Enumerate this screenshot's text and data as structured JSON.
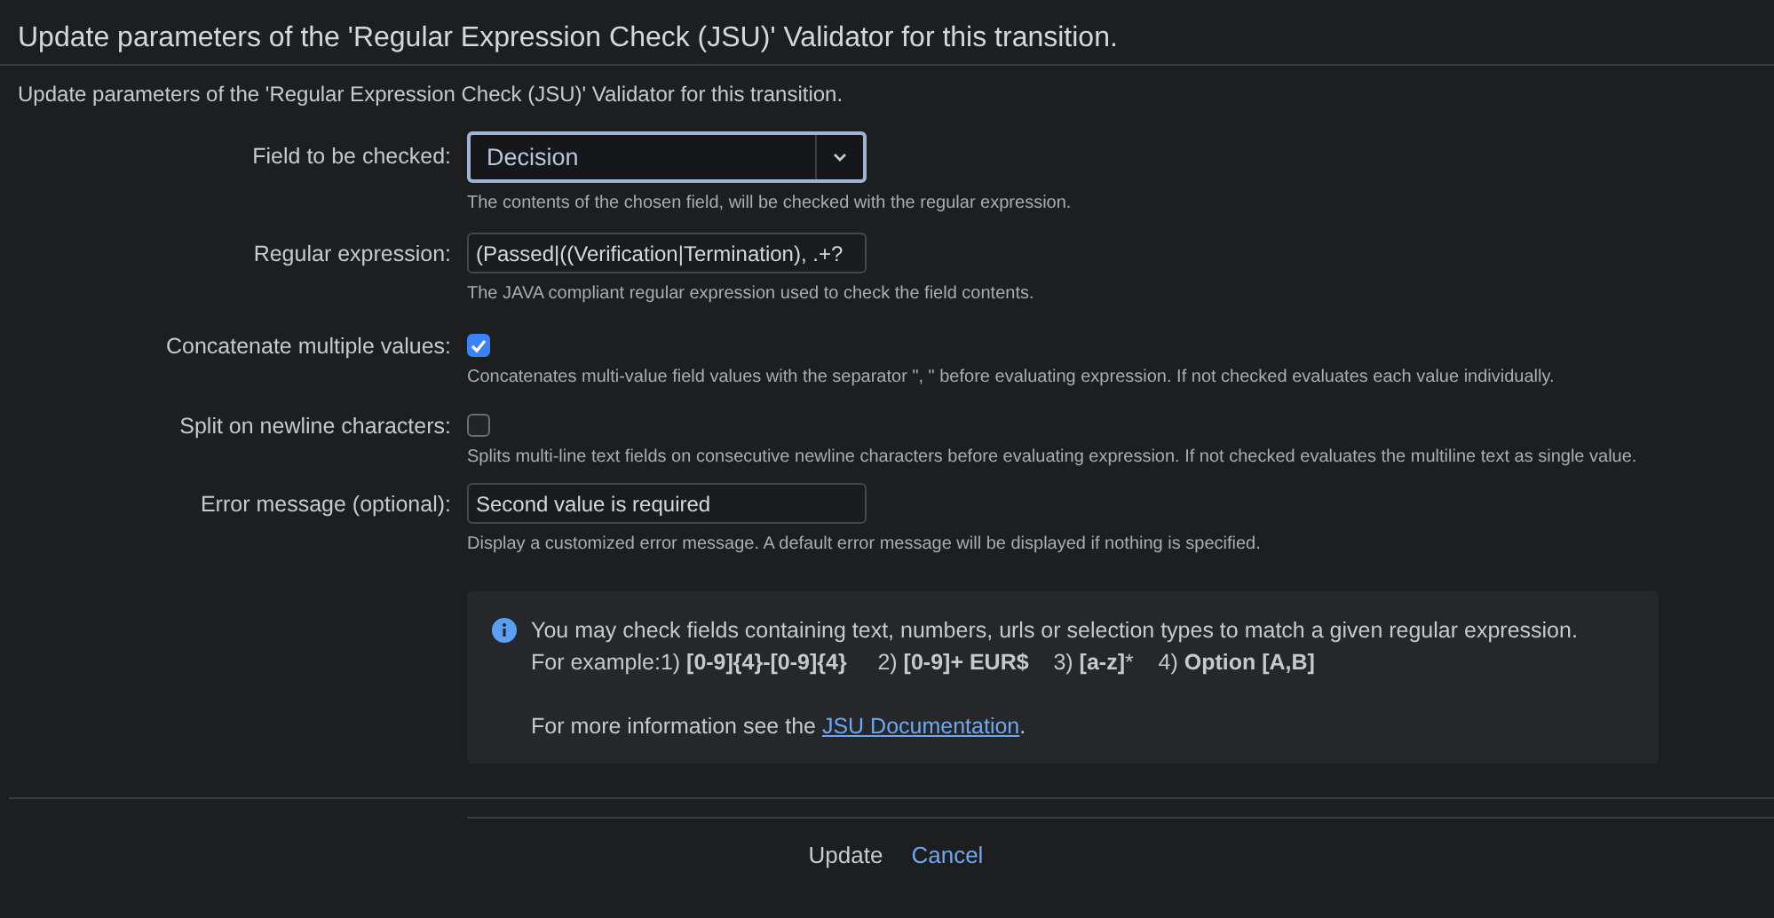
{
  "dialog": {
    "title": "Update parameters of the 'Regular Expression Check (JSU)' Validator for this transition.",
    "subtitle": "Update parameters of the 'Regular Expression Check (JSU)' Validator for this transition."
  },
  "fields": [
    {
      "kind": "select",
      "label": "Field to be checked:",
      "value": "Decision",
      "description": "The contents of the chosen field, will be checked with the regular expression."
    },
    {
      "kind": "text",
      "label": "Regular expression:",
      "value": "(Passed|((Verification|Termination), .+?",
      "description": "The JAVA compliant regular expression used to check the field contents."
    },
    {
      "kind": "checkbox",
      "label": "Concatenate multiple values:",
      "checked": true,
      "description": "Concatenates multi-value field values with the separator \", \" before evaluating expression. If not checked evaluates each value individually."
    },
    {
      "kind": "checkbox",
      "label": "Split on newline characters:",
      "checked": false,
      "description": "Splits multi-line text fields on consecutive newline characters before evaluating expression. If not checked evaluates the multiline text as single value."
    },
    {
      "kind": "text",
      "label": "Error message (optional):",
      "value": "Second value is required",
      "description": "Display a customized error message. A default error message will be displayed if nothing is specified."
    }
  ],
  "info": {
    "lines": [
      "You may check fields containing text, numbers, urls or selection types to match a given regular expression.",
      "For example:1) **[0-9]{4}-[0-9]{4}**     2) **[0-9]+ EUR$**    3) **[a-z]***    4) **Option [A,B]**"
    ],
    "more_prefix": "For more information see the ",
    "link": "JSU Documentation",
    "more_suffix": "."
  },
  "buttons": [
    {
      "kind": "primary",
      "label": "Update"
    },
    {
      "kind": "link",
      "label": "Cancel"
    }
  ]
}
